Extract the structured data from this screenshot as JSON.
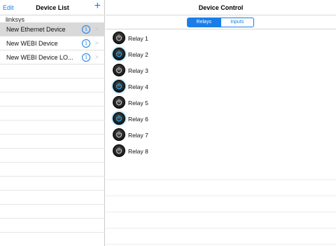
{
  "left_panel": {
    "edit_label": "Edit",
    "title": "Device List",
    "add_label": "+",
    "section_label": "linksys",
    "devices": [
      {
        "name": "New Ethernet Device",
        "selected": true
      },
      {
        "name": "New WEBI Device",
        "selected": false
      },
      {
        "name": "New WEBI Device LO...",
        "selected": false
      }
    ],
    "info_glyph": "i",
    "chevron_glyph": ">"
  },
  "right_panel": {
    "title": "Device Control",
    "tabs": [
      {
        "label": "Relays",
        "active": true
      },
      {
        "label": "Inputs",
        "active": false
      }
    ],
    "relays": [
      {
        "label": "Relay 1",
        "on": false
      },
      {
        "label": "Relay 2",
        "on": true
      },
      {
        "label": "Relay 3",
        "on": false
      },
      {
        "label": "Relay 4",
        "on": true
      },
      {
        "label": "Relay 5",
        "on": false
      },
      {
        "label": "Relay 6",
        "on": true
      },
      {
        "label": "Relay 7",
        "on": false
      },
      {
        "label": "Relay 8",
        "on": false
      }
    ]
  },
  "colors": {
    "accent": "#1a7ee8",
    "relay_on": "#1ea7e8",
    "relay_off": "#bfbfbf",
    "selected_row": "#d9d9d9"
  },
  "icons": {
    "add": "plus-icon",
    "info": "info-circle-icon",
    "chevron": "chevron-right-icon",
    "power": "power-icon"
  }
}
